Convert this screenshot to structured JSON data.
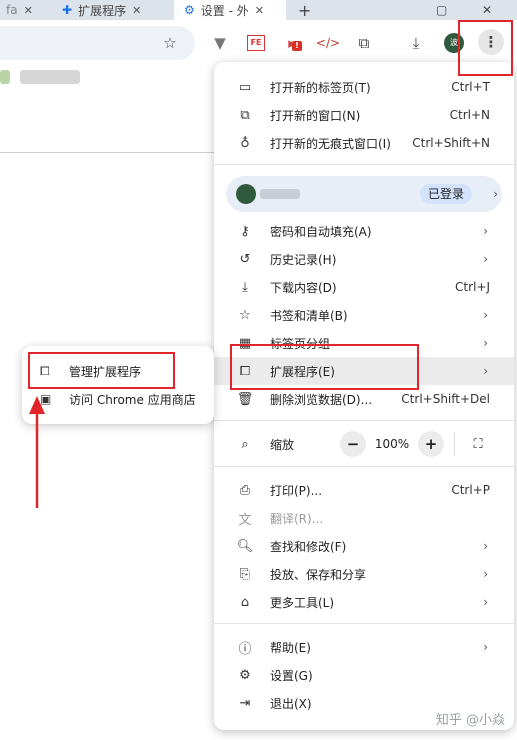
{
  "tabs": [
    {
      "label": "fa",
      "close": "✕"
    },
    {
      "label": "扩展程序",
      "close": "✕"
    },
    {
      "label": "设置 - 外",
      "close": "✕"
    }
  ],
  "new_tab_symbol": "+",
  "menu": {
    "group1": [
      {
        "label": "打开新的标签页(T)",
        "shortcut": "Ctrl+T",
        "icon": "new-tab-icon"
      },
      {
        "label": "打开新的窗口(N)",
        "shortcut": "Ctrl+N",
        "icon": "new-window-icon"
      },
      {
        "label": "打开新的无痕式窗口(I)",
        "shortcut": "Ctrl+Shift+N",
        "icon": "incognito-icon"
      }
    ],
    "profile_status": "已登录",
    "group2": [
      {
        "label": "密码和自动填充(A)",
        "icon": "key-icon"
      },
      {
        "label": "历史记录(H)",
        "icon": "history-icon"
      },
      {
        "label": "下载内容(D)",
        "shortcut": "Ctrl+J",
        "icon": "download-icon"
      },
      {
        "label": "书签和清单(B)",
        "icon": "star-icon"
      },
      {
        "label": "标签页分组",
        "icon": "tab-groups-icon"
      },
      {
        "label": "扩展程序(E)",
        "icon": "extension-icon"
      },
      {
        "label": "删除浏览数据(D)...",
        "shortcut": "Ctrl+Shift+Del",
        "icon": "trash-icon"
      }
    ],
    "zoom": {
      "label": "缩放",
      "value": "100%",
      "minus": "−",
      "plus": "+"
    },
    "group3": [
      {
        "label": "打印(P)...",
        "shortcut": "Ctrl+P",
        "icon": "print-icon"
      },
      {
        "label": "翻译(R)...",
        "icon": "translate-icon"
      },
      {
        "label": "查找和修改(F)",
        "icon": "find-icon"
      },
      {
        "label": "投放、保存和分享",
        "icon": "cast-icon"
      },
      {
        "label": "更多工具(L)",
        "icon": "toolbox-icon"
      }
    ],
    "group4": [
      {
        "label": "帮助(E)",
        "icon": "help-icon"
      },
      {
        "label": "设置(G)",
        "icon": "gear-icon"
      },
      {
        "label": "退出(X)",
        "icon": "exit-icon"
      }
    ]
  },
  "submenu": [
    {
      "label": "管理扩展程序",
      "icon": "extension-icon"
    },
    {
      "label": "访问 Chrome 应用商店",
      "icon": "store-icon"
    }
  ],
  "watermark": "知乎 @小焱",
  "colors": {
    "annotation": "#e0262b",
    "signed_badge": "#d3e3fd"
  }
}
